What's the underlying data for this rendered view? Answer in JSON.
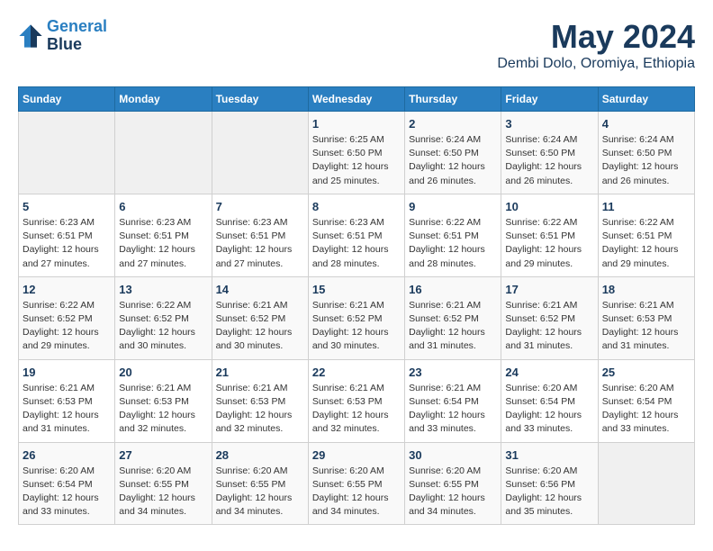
{
  "header": {
    "logo_line1": "General",
    "logo_line2": "Blue",
    "month_year": "May 2024",
    "location": "Dembi Dolo, Oromiya, Ethiopia"
  },
  "weekdays": [
    "Sunday",
    "Monday",
    "Tuesday",
    "Wednesday",
    "Thursday",
    "Friday",
    "Saturday"
  ],
  "weeks": [
    [
      {
        "day": "",
        "info": ""
      },
      {
        "day": "",
        "info": ""
      },
      {
        "day": "",
        "info": ""
      },
      {
        "day": "1",
        "info": "Sunrise: 6:25 AM\nSunset: 6:50 PM\nDaylight: 12 hours\nand 25 minutes."
      },
      {
        "day": "2",
        "info": "Sunrise: 6:24 AM\nSunset: 6:50 PM\nDaylight: 12 hours\nand 26 minutes."
      },
      {
        "day": "3",
        "info": "Sunrise: 6:24 AM\nSunset: 6:50 PM\nDaylight: 12 hours\nand 26 minutes."
      },
      {
        "day": "4",
        "info": "Sunrise: 6:24 AM\nSunset: 6:50 PM\nDaylight: 12 hours\nand 26 minutes."
      }
    ],
    [
      {
        "day": "5",
        "info": "Sunrise: 6:23 AM\nSunset: 6:51 PM\nDaylight: 12 hours\nand 27 minutes."
      },
      {
        "day": "6",
        "info": "Sunrise: 6:23 AM\nSunset: 6:51 PM\nDaylight: 12 hours\nand 27 minutes."
      },
      {
        "day": "7",
        "info": "Sunrise: 6:23 AM\nSunset: 6:51 PM\nDaylight: 12 hours\nand 27 minutes."
      },
      {
        "day": "8",
        "info": "Sunrise: 6:23 AM\nSunset: 6:51 PM\nDaylight: 12 hours\nand 28 minutes."
      },
      {
        "day": "9",
        "info": "Sunrise: 6:22 AM\nSunset: 6:51 PM\nDaylight: 12 hours\nand 28 minutes."
      },
      {
        "day": "10",
        "info": "Sunrise: 6:22 AM\nSunset: 6:51 PM\nDaylight: 12 hours\nand 29 minutes."
      },
      {
        "day": "11",
        "info": "Sunrise: 6:22 AM\nSunset: 6:51 PM\nDaylight: 12 hours\nand 29 minutes."
      }
    ],
    [
      {
        "day": "12",
        "info": "Sunrise: 6:22 AM\nSunset: 6:52 PM\nDaylight: 12 hours\nand 29 minutes."
      },
      {
        "day": "13",
        "info": "Sunrise: 6:22 AM\nSunset: 6:52 PM\nDaylight: 12 hours\nand 30 minutes."
      },
      {
        "day": "14",
        "info": "Sunrise: 6:21 AM\nSunset: 6:52 PM\nDaylight: 12 hours\nand 30 minutes."
      },
      {
        "day": "15",
        "info": "Sunrise: 6:21 AM\nSunset: 6:52 PM\nDaylight: 12 hours\nand 30 minutes."
      },
      {
        "day": "16",
        "info": "Sunrise: 6:21 AM\nSunset: 6:52 PM\nDaylight: 12 hours\nand 31 minutes."
      },
      {
        "day": "17",
        "info": "Sunrise: 6:21 AM\nSunset: 6:52 PM\nDaylight: 12 hours\nand 31 minutes."
      },
      {
        "day": "18",
        "info": "Sunrise: 6:21 AM\nSunset: 6:53 PM\nDaylight: 12 hours\nand 31 minutes."
      }
    ],
    [
      {
        "day": "19",
        "info": "Sunrise: 6:21 AM\nSunset: 6:53 PM\nDaylight: 12 hours\nand 31 minutes."
      },
      {
        "day": "20",
        "info": "Sunrise: 6:21 AM\nSunset: 6:53 PM\nDaylight: 12 hours\nand 32 minutes."
      },
      {
        "day": "21",
        "info": "Sunrise: 6:21 AM\nSunset: 6:53 PM\nDaylight: 12 hours\nand 32 minutes."
      },
      {
        "day": "22",
        "info": "Sunrise: 6:21 AM\nSunset: 6:53 PM\nDaylight: 12 hours\nand 32 minutes."
      },
      {
        "day": "23",
        "info": "Sunrise: 6:21 AM\nSunset: 6:54 PM\nDaylight: 12 hours\nand 33 minutes."
      },
      {
        "day": "24",
        "info": "Sunrise: 6:20 AM\nSunset: 6:54 PM\nDaylight: 12 hours\nand 33 minutes."
      },
      {
        "day": "25",
        "info": "Sunrise: 6:20 AM\nSunset: 6:54 PM\nDaylight: 12 hours\nand 33 minutes."
      }
    ],
    [
      {
        "day": "26",
        "info": "Sunrise: 6:20 AM\nSunset: 6:54 PM\nDaylight: 12 hours\nand 33 minutes."
      },
      {
        "day": "27",
        "info": "Sunrise: 6:20 AM\nSunset: 6:55 PM\nDaylight: 12 hours\nand 34 minutes."
      },
      {
        "day": "28",
        "info": "Sunrise: 6:20 AM\nSunset: 6:55 PM\nDaylight: 12 hours\nand 34 minutes."
      },
      {
        "day": "29",
        "info": "Sunrise: 6:20 AM\nSunset: 6:55 PM\nDaylight: 12 hours\nand 34 minutes."
      },
      {
        "day": "30",
        "info": "Sunrise: 6:20 AM\nSunset: 6:55 PM\nDaylight: 12 hours\nand 34 minutes."
      },
      {
        "day": "31",
        "info": "Sunrise: 6:20 AM\nSunset: 6:56 PM\nDaylight: 12 hours\nand 35 minutes."
      },
      {
        "day": "",
        "info": ""
      }
    ]
  ]
}
